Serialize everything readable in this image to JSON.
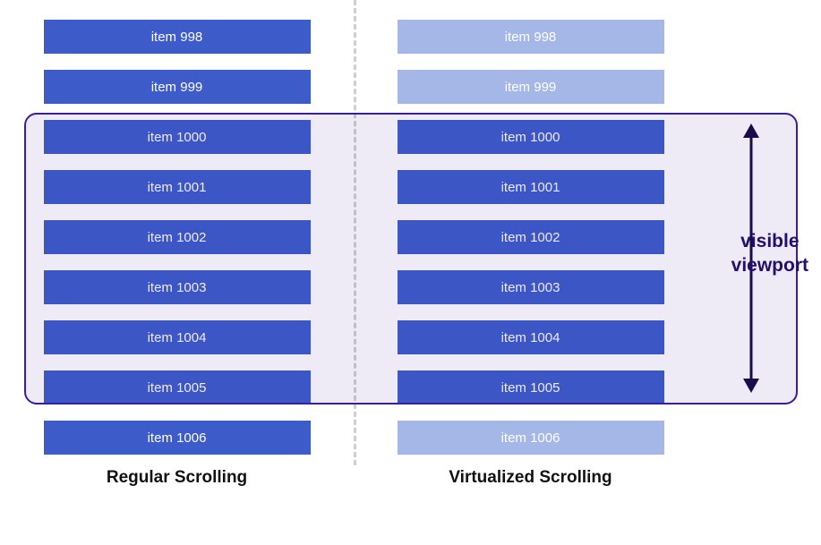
{
  "left": {
    "title": "Regular Scrolling",
    "items": [
      {
        "label": "item 998",
        "faded": false
      },
      {
        "label": "item 999",
        "faded": false
      },
      {
        "label": "item 1000",
        "faded": false
      },
      {
        "label": "item 1001",
        "faded": false
      },
      {
        "label": "item 1002",
        "faded": false
      },
      {
        "label": "item 1003",
        "faded": false
      },
      {
        "label": "item 1004",
        "faded": false
      },
      {
        "label": "item 1005",
        "faded": false
      },
      {
        "label": "item 1006",
        "faded": false
      }
    ]
  },
  "right": {
    "title": "Virtualized Scrolling",
    "items": [
      {
        "label": "item 998",
        "faded": true
      },
      {
        "label": "item 999",
        "faded": true
      },
      {
        "label": "item 1000",
        "faded": false
      },
      {
        "label": "item 1001",
        "faded": false
      },
      {
        "label": "item 1002",
        "faded": false
      },
      {
        "label": "item 1003",
        "faded": false
      },
      {
        "label": "item 1004",
        "faded": false
      },
      {
        "label": "item 1005",
        "faded": false
      },
      {
        "label": "item 1006",
        "faded": true
      }
    ]
  },
  "viewport_label_line1": "visible",
  "viewport_label_line2": "viewport"
}
